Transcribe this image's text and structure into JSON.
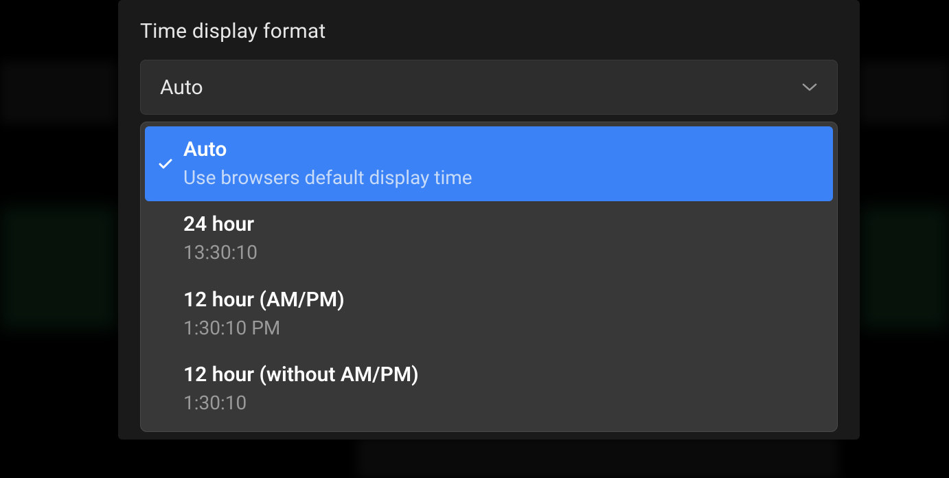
{
  "label": "Time display format",
  "select": {
    "current_value": "Auto"
  },
  "options": [
    {
      "title": "Auto",
      "description": "Use browsers default display time",
      "selected": true
    },
    {
      "title": "24 hour",
      "description": "13:30:10",
      "selected": false
    },
    {
      "title": "12 hour (AM/PM)",
      "description": "1:30:10 PM",
      "selected": false
    },
    {
      "title": "12 hour (without AM/PM)",
      "description": "1:30:10",
      "selected": false
    }
  ],
  "colors": {
    "panel_bg": "#1a1a1a",
    "select_bg": "#2d2d2d",
    "dropdown_bg": "#383838",
    "selected_bg": "#3B82F6",
    "text_primary": "#ffffff",
    "text_secondary": "#9a9a9a"
  }
}
